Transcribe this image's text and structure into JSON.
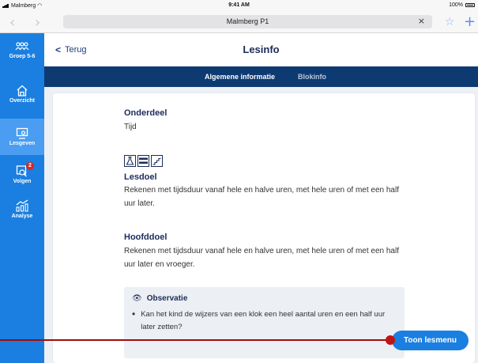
{
  "status": {
    "carrier": "Malmberg",
    "time": "9:41 AM",
    "battery": "100%"
  },
  "browser": {
    "url": "Malmberg P1",
    "back_icon": "chevron-left-icon",
    "forward_icon": "chevron-right-icon",
    "clear_icon": "close-icon",
    "bookmark_icon": "star-icon",
    "new_tab_icon": "plus-icon"
  },
  "sidebar": {
    "items": [
      {
        "label": "Groep 5-6",
        "icon": "group-icon"
      },
      {
        "label": "Overzicht",
        "icon": "home-icon"
      },
      {
        "label": "Lesgeven",
        "icon": "teach-icon",
        "active": true
      },
      {
        "label": "Volgen",
        "icon": "follow-icon",
        "badge": "2"
      },
      {
        "label": "Analyse",
        "icon": "chart-icon"
      }
    ]
  },
  "header": {
    "back_label": "Terug",
    "title": "Lesinfo"
  },
  "tabs": [
    {
      "label": "Algemene informatie",
      "active": true
    },
    {
      "label": "Blokinfo",
      "active": false
    }
  ],
  "content": {
    "onderdeel_heading": "Onderdeel",
    "onderdeel_value": "Tijd",
    "lesdoel_heading": "Lesdoel",
    "lesdoel_text": "Rekenen met tijdsduur vanaf hele en halve uren, met hele uren of met een half uur later.",
    "hoofddoel_heading": "Hoofddoel",
    "hoofddoel_text": "Rekenen met tijdsduur vanaf hele en halve uren, met hele uren of met een half uur later en vroeger.",
    "observatie_heading": "Observatie",
    "observatie_item": "Kan het kind de wijzers van een klok een heel aantal uren en een half uur later zetten?"
  },
  "action": {
    "toon_lesmenu_label": "Toon lesmenu"
  },
  "colors": {
    "sidebar": "#1a7fe0",
    "subnav": "#0e3a72",
    "annotation": "#c11414",
    "accent": "#1a7fe0"
  }
}
